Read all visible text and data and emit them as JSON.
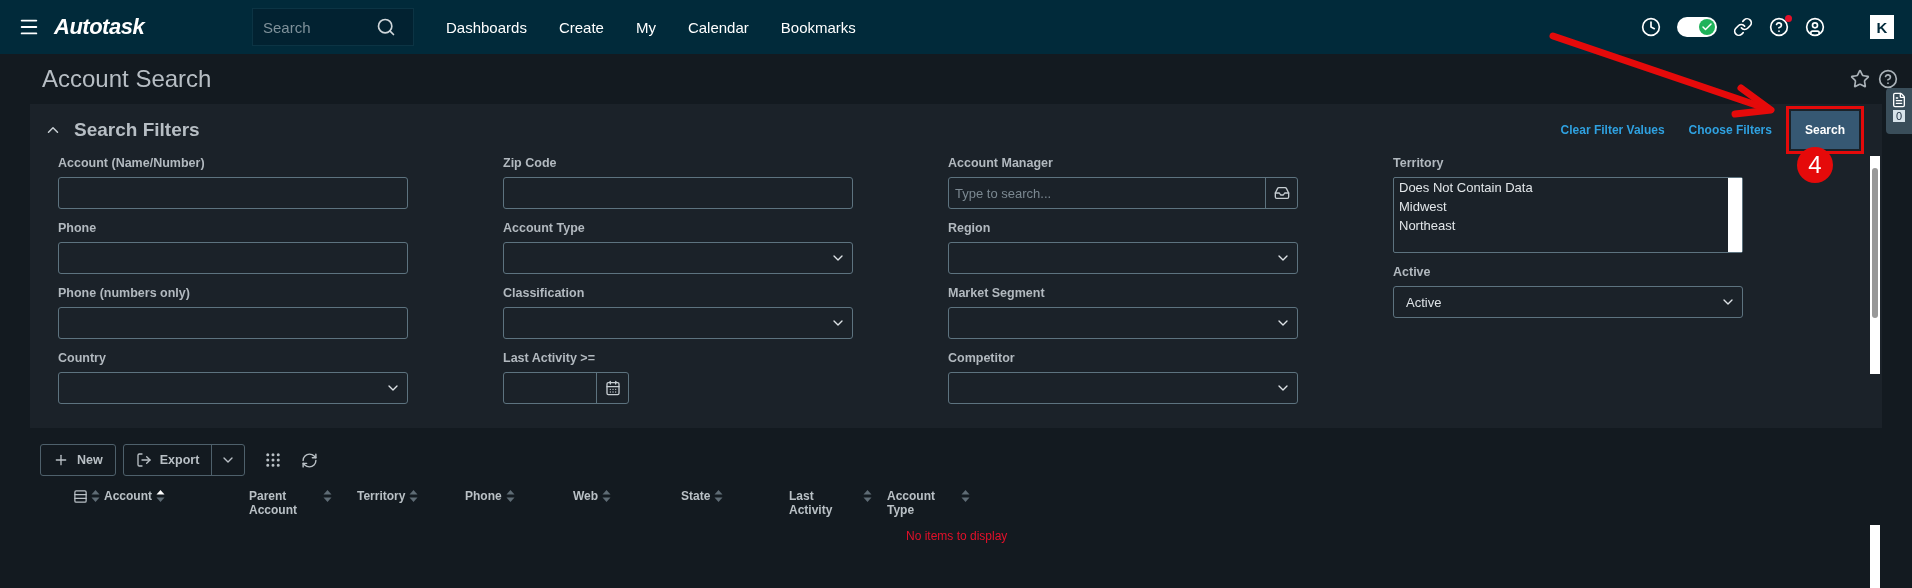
{
  "topbar": {
    "logo": "Autotask",
    "search": {
      "placeholder": "Search"
    },
    "nav": [
      "Dashboards",
      "Create",
      "My",
      "Calendar",
      "Bookmarks"
    ],
    "status_toggle": {
      "on": true
    },
    "help_notification": true,
    "app_badge": "K"
  },
  "page": {
    "title": "Account Search"
  },
  "side_tab": {
    "count": "0"
  },
  "filters": {
    "title": "Search Filters",
    "expanded": true,
    "links": [
      "Clear Filter Values",
      "Choose Filters"
    ],
    "search_button": "Search",
    "columns": [
      [
        {
          "kind": "text",
          "label": "Account (Name/Number)"
        },
        {
          "kind": "text",
          "label": "Phone"
        },
        {
          "kind": "text",
          "label": "Phone (numbers only)"
        },
        {
          "kind": "select",
          "label": "Country"
        }
      ],
      [
        {
          "kind": "text",
          "label": "Zip Code"
        },
        {
          "kind": "select",
          "label": "Account Type"
        },
        {
          "kind": "select",
          "label": "Classification"
        },
        {
          "kind": "date",
          "label": "Last Activity >="
        }
      ],
      [
        {
          "kind": "lookup",
          "label": "Account Manager",
          "placeholder": "Type to search..."
        },
        {
          "kind": "select",
          "label": "Region"
        },
        {
          "kind": "select",
          "label": "Market Segment"
        },
        {
          "kind": "select",
          "label": "Competitor"
        }
      ],
      [
        {
          "kind": "listbox",
          "label": "Territory",
          "options": [
            "Does Not Contain Data",
            "Midwest",
            "Northeast"
          ]
        },
        {
          "kind": "select",
          "label": "Active",
          "value": "Active"
        }
      ]
    ]
  },
  "toolbar": {
    "new": "New",
    "export": "Export"
  },
  "table": {
    "columns": [
      {
        "label": "Account",
        "sorted": true
      },
      {
        "label": "Parent Account",
        "sorted": false
      },
      {
        "label": "Territory",
        "sorted": false
      },
      {
        "label": "Phone",
        "sorted": false
      },
      {
        "label": "Web",
        "sorted": false
      },
      {
        "label": "State",
        "sorted": false
      },
      {
        "label": "Last Activity",
        "sorted": false
      },
      {
        "label": "Account Type",
        "sorted": false
      }
    ],
    "empty_message": "No items to display"
  },
  "annotation": {
    "step": "4",
    "highlight": true
  }
}
